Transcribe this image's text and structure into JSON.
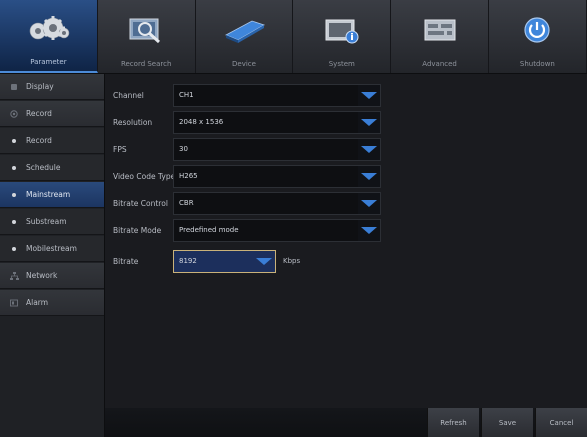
{
  "tabs": [
    {
      "label": "Parameter",
      "icon": "gears-icon",
      "active": true
    },
    {
      "label": "Record Search",
      "icon": "magnifier-icon"
    },
    {
      "label": "Device",
      "icon": "hard-drive-icon"
    },
    {
      "label": "System",
      "icon": "system-info-icon"
    },
    {
      "label": "Advanced",
      "icon": "advanced-board-icon"
    },
    {
      "label": "Shutdown",
      "icon": "power-icon"
    }
  ],
  "sidebar": {
    "items": [
      {
        "label": "Display",
        "type": "section",
        "icon": "display-icon"
      },
      {
        "label": "Record",
        "type": "section",
        "icon": "record-icon"
      },
      {
        "label": "Record",
        "type": "sub"
      },
      {
        "label": "Schedule",
        "type": "sub"
      },
      {
        "label": "Mainstream",
        "type": "sub",
        "active": true
      },
      {
        "label": "Substream",
        "type": "sub"
      },
      {
        "label": "Mobilestream",
        "type": "sub"
      },
      {
        "label": "Network",
        "type": "section",
        "icon": "network-icon"
      },
      {
        "label": "Alarm",
        "type": "section",
        "icon": "alarm-icon"
      }
    ]
  },
  "form": {
    "channel": {
      "label": "Channel",
      "value": "CH1"
    },
    "resolution": {
      "label": "Resolution",
      "value": "2048 x 1536"
    },
    "fps": {
      "label": "FPS",
      "value": "30"
    },
    "video_code_type": {
      "label": "Video Code Type",
      "value": "H265"
    },
    "bitrate_control": {
      "label": "Bitrate Control",
      "value": "CBR"
    },
    "bitrate_mode": {
      "label": "Bitrate Mode",
      "value": "Predefined mode"
    },
    "bitrate": {
      "label": "Bitrate",
      "value": "8192",
      "unit": "Kbps"
    }
  },
  "buttons": {
    "refresh": "Refresh",
    "save": "Save",
    "cancel": "Cancel"
  },
  "colors": {
    "accent": "#3a7ed6",
    "active_tab": "#1b3763",
    "focus_border": "#c9b27a"
  }
}
